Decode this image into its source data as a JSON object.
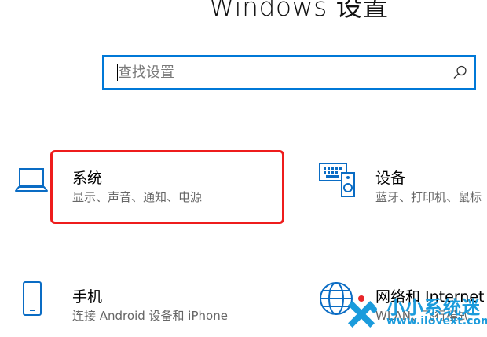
{
  "header": {
    "title": "Windows 设置"
  },
  "search": {
    "placeholder": "查找设置",
    "value": ""
  },
  "tiles": [
    {
      "title": "系统",
      "desc": "显示、声音、通知、电源",
      "icon": "laptop-icon",
      "highlighted": true
    },
    {
      "title": "设备",
      "desc": "蓝牙、打印机、鼠标",
      "icon": "keyboard-speaker-icon",
      "highlighted": false
    },
    {
      "title": "手机",
      "desc": "连接 Android 设备和 iPhone",
      "icon": "phone-icon",
      "highlighted": false
    },
    {
      "title": "网络和 Internet",
      "desc": "WLAN、飞行模式",
      "icon": "globe-icon",
      "highlighted": false
    }
  ],
  "watermark": {
    "name": "小小系统迷",
    "url": "www.ilovext.com"
  },
  "colors": {
    "accent": "#0078d7",
    "highlight": "#ee1c1c",
    "watermark": "#1a9bdc"
  }
}
